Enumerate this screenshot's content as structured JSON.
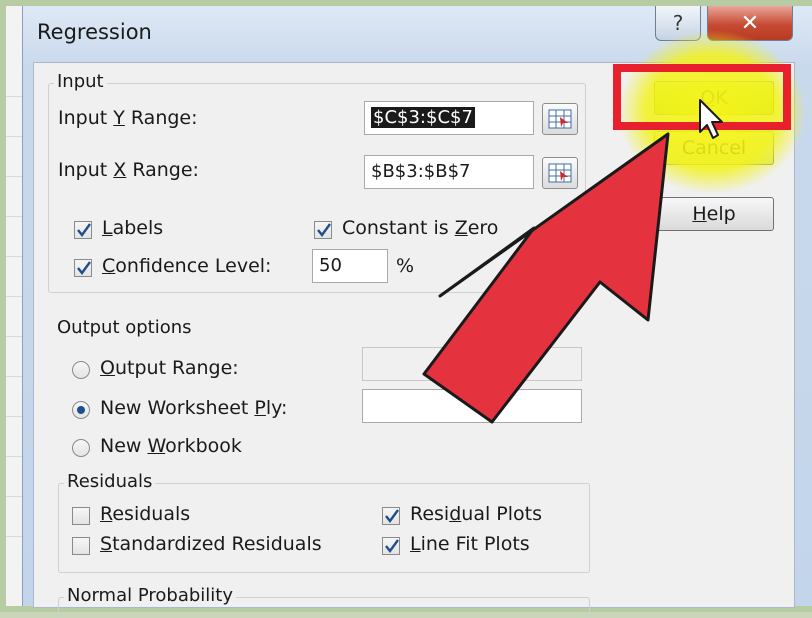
{
  "window": {
    "title": "Regression",
    "help_glyph": "?",
    "close_glyph": "✕"
  },
  "input": {
    "group_label": "Input",
    "y_range_label_pre": "Input ",
    "y_range_label_key": "Y",
    "y_range_label_post": " Range:",
    "y_range_value": "$C$3:$C$7",
    "x_range_label_pre": "Input ",
    "x_range_label_key": "X",
    "x_range_label_post": " Range:",
    "x_range_value": "$B$3:$B$7",
    "labels_key": "L",
    "labels_rest": "abels",
    "labels_checked": true,
    "constant_zero_pre": "Constant is ",
    "constant_zero_key": "Z",
    "constant_zero_post": "ero",
    "constant_zero_checked": true,
    "confidence_key": "C",
    "confidence_rest": "onfidence Level:",
    "confidence_checked": true,
    "confidence_value": "50",
    "percent_sign": "%"
  },
  "output": {
    "group_label": "Output options",
    "output_range_key": "O",
    "output_range_rest": "utput Range:",
    "output_range_selected": false,
    "new_ply_pre": "New Worksheet ",
    "new_ply_key": "P",
    "new_ply_post": "ly:",
    "new_ply_selected": true,
    "new_workbook_pre": "New ",
    "new_workbook_key": "W",
    "new_workbook_post": "orkbook",
    "new_workbook_selected": false
  },
  "residuals": {
    "group_label": "Residuals",
    "residuals_key": "R",
    "residuals_rest": "esiduals",
    "residuals_checked": false,
    "standardized_pre": "",
    "standardized_key": "S",
    "standardized_post": "tandardized Residuals",
    "standardized_checked": false,
    "residual_plots_pre": "Resi",
    "residual_plots_key": "d",
    "residual_plots_post": "ual Plots",
    "residual_plots_checked": true,
    "line_fit_pre": "",
    "line_fit_key": "L",
    "line_fit_post": "ine Fit Plots",
    "line_fit_checked": true
  },
  "normal_probability": {
    "group_label": "Normal Probability"
  },
  "buttons": {
    "ok_key": "O",
    "ok_rest": "K",
    "cancel_label": "Cancel",
    "help_key": "H",
    "help_rest": "elp"
  },
  "colors": {
    "highlight_ring": "#e8202e",
    "spotlight": "#f2f21a",
    "arrow_fill": "#e5323f",
    "ok_button": "#c8ec3c"
  }
}
